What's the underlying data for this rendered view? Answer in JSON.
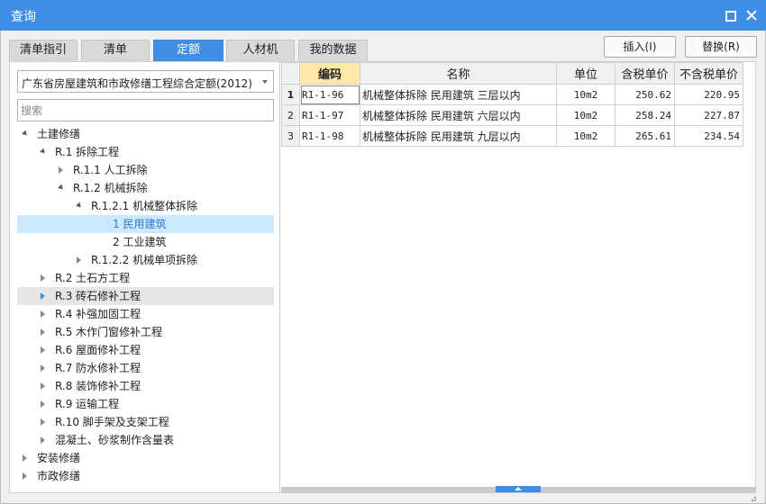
{
  "window": {
    "title": "查询"
  },
  "tabs": [
    "清单指引",
    "清单",
    "定额",
    "人材机",
    "我的数据"
  ],
  "buttons": {
    "insert": "插入(I)",
    "replace": "替换(R)"
  },
  "library": {
    "selected": "广东省房屋建筑和市政修缮工程综合定额(2012)"
  },
  "search": {
    "placeholder": "搜索",
    "value": ""
  },
  "tree": [
    {
      "label": "土建修缮",
      "state": "expanded",
      "level": 0
    },
    {
      "label": "R.1 拆除工程",
      "state": "expanded",
      "level": 1
    },
    {
      "label": "R.1.1 人工拆除",
      "state": "collapsed",
      "level": 2
    },
    {
      "label": "R.1.2 机械拆除",
      "state": "expanded",
      "level": 2
    },
    {
      "label": "R.1.2.1 机械整体拆除",
      "state": "expanded",
      "level": 3
    },
    {
      "label": "1 民用建筑",
      "state": "leaf",
      "level": 4,
      "selected": true
    },
    {
      "label": "2 工业建筑",
      "state": "leaf",
      "level": 4
    },
    {
      "label": "R.1.2.2 机械单项拆除",
      "state": "collapsed",
      "level": 3
    },
    {
      "label": "R.2 土石方工程",
      "state": "collapsed",
      "level": 1
    },
    {
      "label": "R.3 砖石修补工程",
      "state": "collapsed",
      "level": 1,
      "hover": true
    },
    {
      "label": "R.4 补强加固工程",
      "state": "collapsed",
      "level": 1
    },
    {
      "label": "R.5 木作门窗修补工程",
      "state": "collapsed",
      "level": 1
    },
    {
      "label": "R.6 屋面修补工程",
      "state": "collapsed",
      "level": 1
    },
    {
      "label": "R.7 防水修补工程",
      "state": "collapsed",
      "level": 1
    },
    {
      "label": "R.8 装饰修补工程",
      "state": "collapsed",
      "level": 1
    },
    {
      "label": "R.9 运输工程",
      "state": "collapsed",
      "level": 1
    },
    {
      "label": "R.10 脚手架及支架工程",
      "state": "collapsed",
      "level": 1
    },
    {
      "label": "混凝土、砂浆制作含量表",
      "state": "collapsed",
      "level": 1
    },
    {
      "label": "安装修缮",
      "state": "collapsed",
      "level": 0
    },
    {
      "label": "市政修缮",
      "state": "collapsed",
      "level": 0
    }
  ],
  "table": {
    "columns": [
      "编码",
      "名称",
      "单位",
      "含税单价",
      "不含税单价"
    ],
    "rows": [
      {
        "num": "1",
        "code": "R1-1-96",
        "name": "机械整体拆除 民用建筑 三层以内",
        "unit": "10m2",
        "price_tax": "250.62",
        "price_notax": "220.95"
      },
      {
        "num": "2",
        "code": "R1-1-97",
        "name": "机械整体拆除 民用建筑 六层以内",
        "unit": "10m2",
        "price_tax": "258.24",
        "price_notax": "227.87"
      },
      {
        "num": "3",
        "code": "R1-1-98",
        "name": "机械整体拆除 民用建筑 九层以内",
        "unit": "10m2",
        "price_tax": "265.61",
        "price_notax": "234.54"
      }
    ]
  },
  "colors": {
    "accent": "#3d8ee4",
    "selected_row": "#cce8ff",
    "code_header": "#fde7a9"
  }
}
